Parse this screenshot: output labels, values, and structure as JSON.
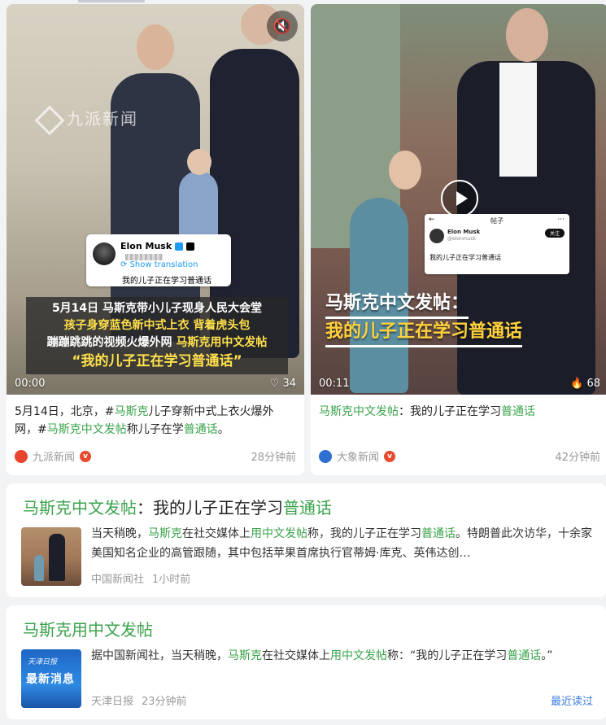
{
  "cards": [
    {
      "video_time": "00:00",
      "likes": "34",
      "watermark": "九派新闻",
      "tweet": {
        "name": "Elon Musk",
        "translate": "Show translation",
        "text": "我的儿子正在学习普通话"
      },
      "caption": {
        "line1": "5月14日  马斯克带小儿子现身人民大会堂",
        "line2": "孩子身穿蓝色新中式上衣  背着虎头包",
        "line3_a": "蹦蹦跳跳的视频火爆外网  ",
        "line3_b": "马斯克用中文发帖",
        "line4": "“我的儿子正在学习普通话”"
      },
      "desc": {
        "p1": "5月14日，北京，#",
        "h1": "马斯克",
        "p2": "儿子穿新中式上衣火爆外网，#",
        "h2": "马斯克中文发帖",
        "p3": "称儿子在学",
        "h3": "普通话",
        "p4": "。"
      },
      "source": "九派新闻",
      "ago": "28分钟前"
    },
    {
      "video_time": "00:11",
      "likes": "68",
      "phone": {
        "title": "帖子",
        "name": "Elon Musk",
        "handle": "@elonmusk",
        "follow": "关注",
        "text": "我的儿子正在学习普通话"
      },
      "headline1": "马斯克中文发帖：",
      "headline2": "我的儿子正在学习普通话",
      "desc": {
        "h1": "马斯克中文发帖",
        "p1": "：我的儿子正在学习",
        "h2": "普通话"
      },
      "source": "大象新闻",
      "ago": "42分钟前"
    }
  ],
  "news": [
    {
      "title_h": "马斯克中文发帖",
      "title_p": "：我的儿子正在学习",
      "title_h2": "普通话",
      "body": {
        "p1": "当天稍晚，",
        "h1": "马斯克",
        "p2": "在社交媒体上",
        "h2": "用中文发帖",
        "p3": "称，我的儿子正在学习",
        "h3": "普通话",
        "p4": "。特朗普此次访华，十余家美国知名企业的高管跟随，其中包括苹果首席执行官蒂姆·库克、英伟达创…"
      },
      "source": "中国新闻社",
      "ago": "1小时前"
    },
    {
      "title_h": "马斯克用中文发帖",
      "thumb_a": "天津日报",
      "thumb_b": "最新消息",
      "body": {
        "p1": "据中国新闻社，当天稍晚，",
        "h1": "马斯克",
        "p2": "在社交媒体上",
        "h2": "用中文发帖",
        "p3": "称：“我的儿子正在学习",
        "h3": "普通话",
        "p4": "。”"
      },
      "source": "天津日报",
      "ago": "23分钟前",
      "recent": "最近读过"
    }
  ],
  "colors": {
    "highlight": "#3aa34b",
    "link": "#3b7ddd",
    "badge": "#e84a2f"
  }
}
